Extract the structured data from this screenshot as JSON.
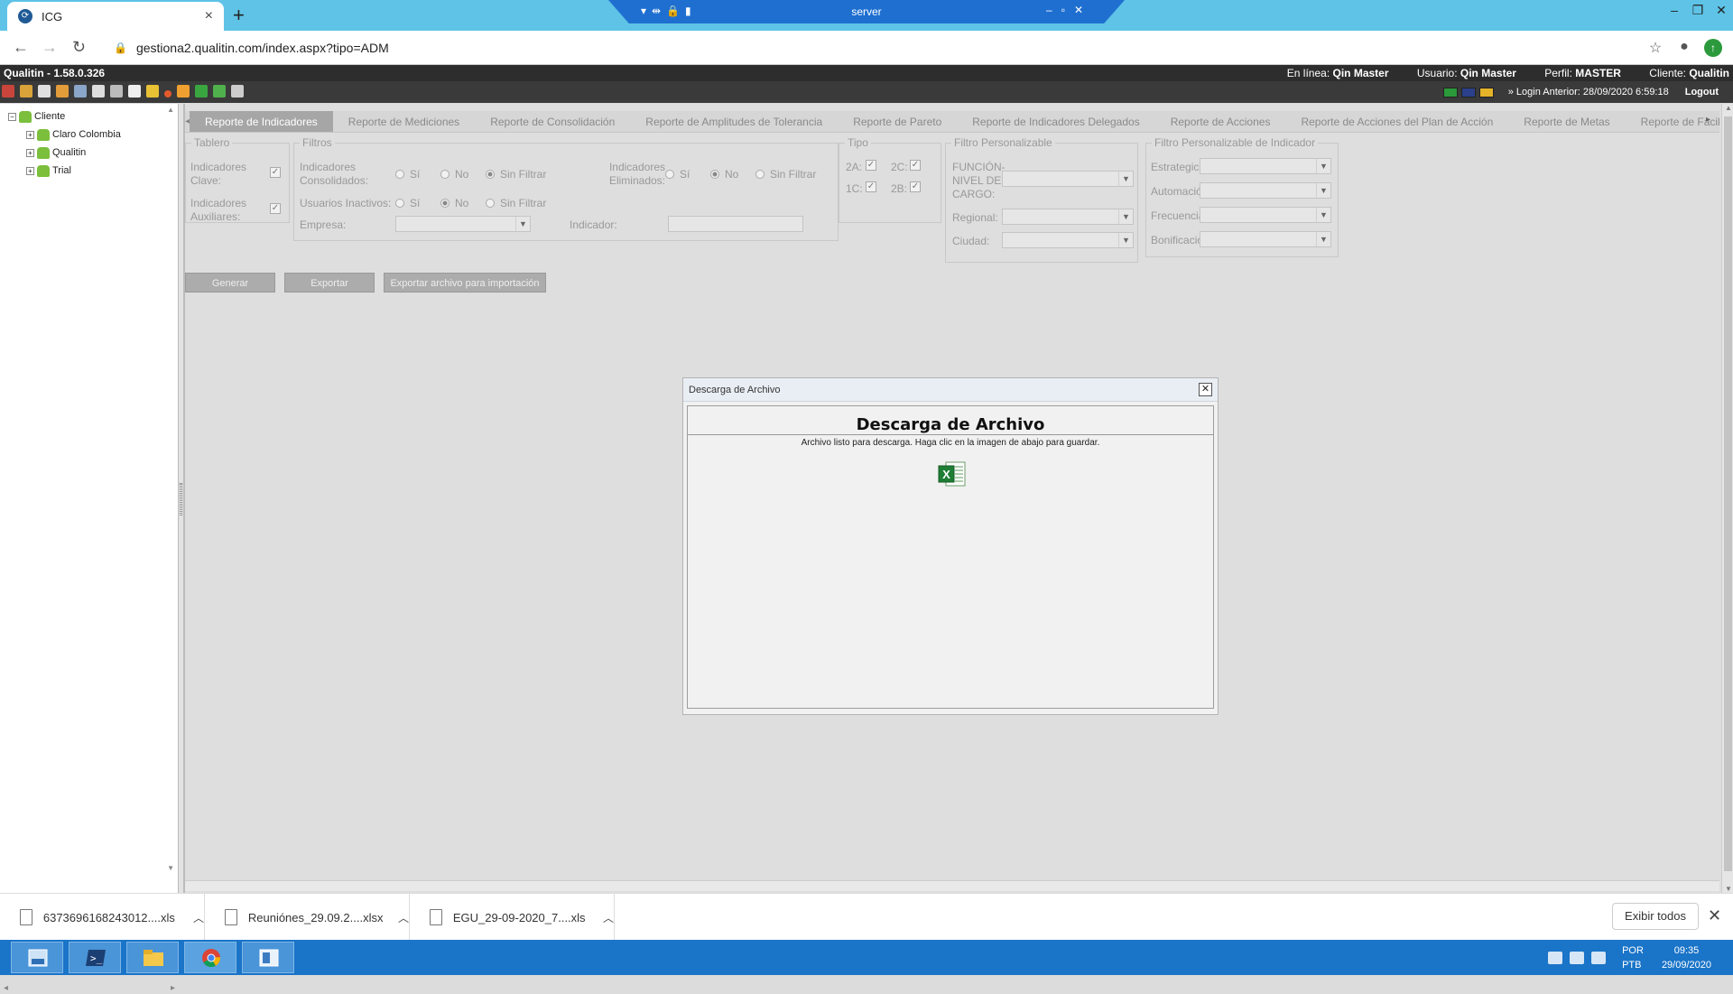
{
  "browser": {
    "tab_title": "ICG",
    "tab_close": "×",
    "new_tab": "+",
    "url": "gestiona2.qualitin.com/index.aspx?tipo=ADM",
    "rdp_title": "server"
  },
  "app": {
    "version": "Qualitin - 1.58.0.326",
    "online_label": "En línea:",
    "online_value": "Qin Master",
    "user_label": "Usuario:",
    "user_value": "Qin Master",
    "profile_label": "Perfil:",
    "profile_value": "MASTER",
    "client_label": "Cliente:",
    "client_value": "Qualitin",
    "last_login": "Login Anterior: 28/09/2020 6:59:18",
    "logout": "Logout"
  },
  "tree": {
    "root": "Cliente",
    "children": [
      "Claro Colombia",
      "Qualitin",
      "Trial"
    ]
  },
  "report_tabs": [
    "Reporte de Indicadores",
    "Reporte de Mediciones",
    "Reporte de Consolidación",
    "Reporte de Amplitudes de Tolerancia",
    "Reporte de Pareto",
    "Reporte de Indicadores Delegados",
    "Reporte de Acciones",
    "Reporte de Acciones del Plan de Acción",
    "Reporte de Metas",
    "Reporte de Facilit"
  ],
  "tablero": {
    "legend": "Tablero",
    "clave_line1": "Indicadores",
    "clave_line2": "Clave:",
    "aux_line1": "Indicadores",
    "aux_line2": "Auxiliares:"
  },
  "filtros": {
    "legend": "Filtros",
    "consolidados_line1": "Indicadores",
    "consolidados_line2": "Consolidados:",
    "eliminados_line1": "Indicadores",
    "eliminados_line2": "Eliminados:",
    "inactivos": "Usuarios Inactivos:",
    "empresa": "Empresa:",
    "indicador": "Indicador:",
    "opt_si": "Sí",
    "opt_no": "No",
    "opt_sin": "Sin Filtrar"
  },
  "tipo": {
    "legend": "Tipo",
    "labels": [
      "2A:",
      "2C:",
      "1C:",
      "2B:"
    ]
  },
  "filtro_personalizable": {
    "legend": "Filtro Personalizable",
    "funcion_l1": "FUNCIÓN-",
    "funcion_l2": "NIVEL DE",
    "funcion_l3": "CARGO:",
    "regional": "Regional:",
    "ciudad": "Ciudad:"
  },
  "filtro_indicador": {
    "legend": "Filtro Personalizable de Indicador",
    "labels": [
      "Estrategico",
      "Automació",
      "Frecuencia",
      "Bonificació"
    ]
  },
  "buttons": {
    "generar": "Generar",
    "exportar": "Exportar",
    "exportar_importacion": "Exportar archivo para importación"
  },
  "modal": {
    "header": "Descarga de Archivo",
    "title": "Descarga de Archivo",
    "message": "Archivo listo para descarga. Haga clic en la imagen de abajo para guardar.",
    "icon": "excel-file-icon"
  },
  "downloads": {
    "items": [
      "6373696168243012....xls",
      "Reuniónes_29.09.2....xlsx",
      "EGU_29-09-2020_7....xls"
    ],
    "show_all": "Exibir todos"
  },
  "taskbar": {
    "lang1": "POR",
    "lang2": "PTB",
    "time": "09:35",
    "date": "29/09/2020"
  },
  "colors": {
    "browser_tab_bar": "#5ec3e6",
    "app_header": "#2d2d2d",
    "active_tab": "#a6a6a6",
    "taskbar": "#1a74c8",
    "excel_green": "#1e7e34"
  }
}
